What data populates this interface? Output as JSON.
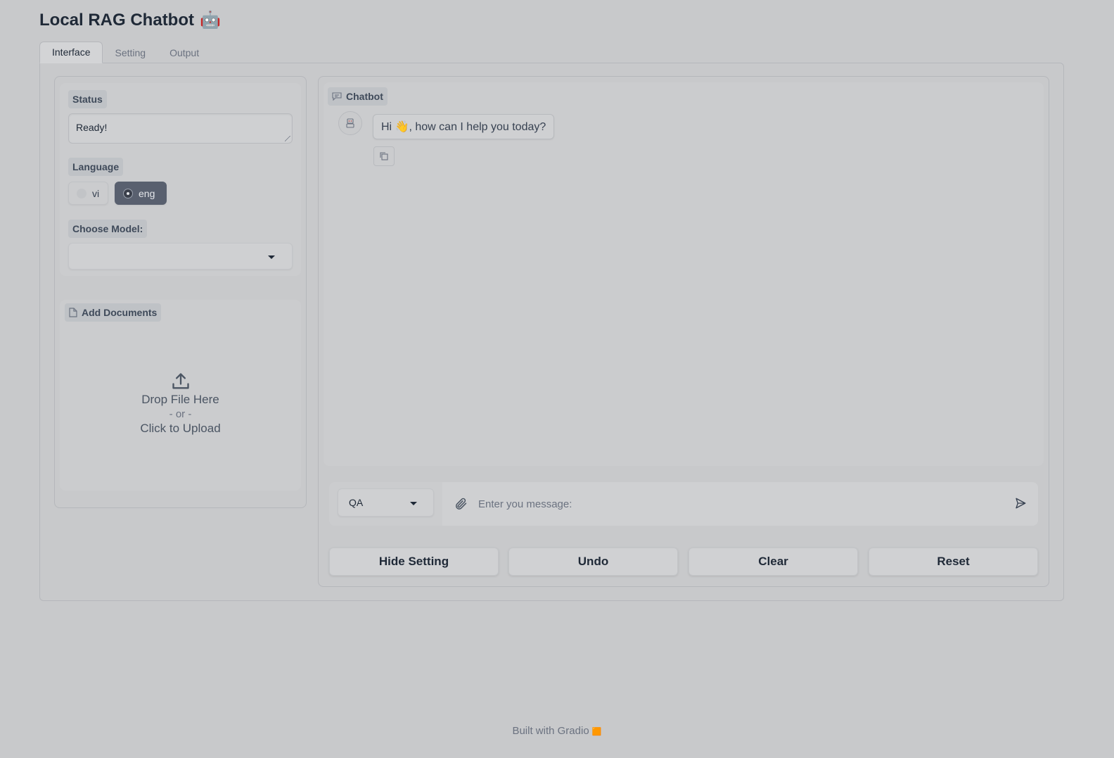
{
  "app": {
    "title": "Local RAG Chatbot",
    "title_emoji": "🤖"
  },
  "tabs": [
    {
      "label": "Interface",
      "active": true
    },
    {
      "label": "Setting",
      "active": false
    },
    {
      "label": "Output",
      "active": false
    }
  ],
  "left": {
    "status_label": "Status",
    "status_value": "Ready!",
    "language_label": "Language",
    "language_options": [
      {
        "label": "vi",
        "selected": false
      },
      {
        "label": "eng",
        "selected": true
      }
    ],
    "model_label": "Choose Model:",
    "model_value": "",
    "upload_label": "Add Documents",
    "upload_line1": "Drop File Here",
    "upload_line2": "- or -",
    "upload_line3": "Click to Upload"
  },
  "chat": {
    "label": "Chatbot",
    "messages": [
      {
        "role": "bot",
        "text": "Hi 👋, how can I help you today?"
      }
    ],
    "mode_value": "QA",
    "input_placeholder": "Enter you message:"
  },
  "buttons": {
    "hide_setting": "Hide Setting",
    "undo": "Undo",
    "clear": "Clear",
    "reset": "Reset"
  },
  "footer": {
    "text": "Built with Gradio",
    "icon": "🟧"
  },
  "colors": {
    "background": "#c8c9cb",
    "selected_radio": "#59606f",
    "label_chip": "#bfc2c6"
  }
}
